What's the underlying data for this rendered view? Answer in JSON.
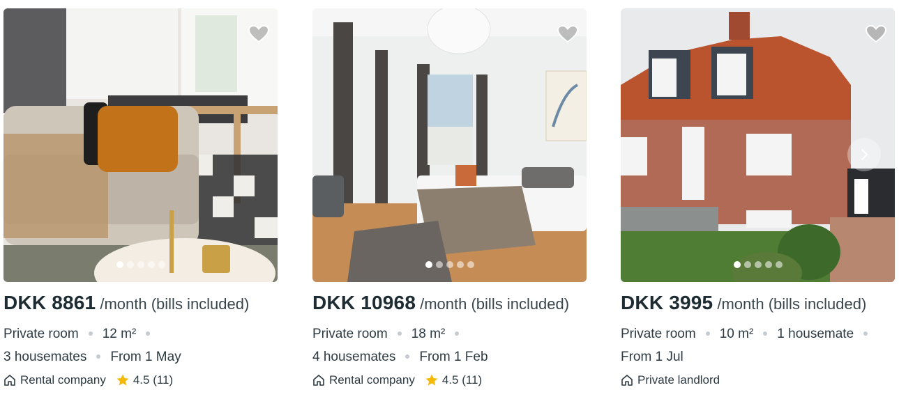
{
  "listings": [
    {
      "price": "DKK 8861",
      "period": "/month (bills included)",
      "room_type": "Private room",
      "size": "12 m²",
      "housemates": "3 housemates",
      "available": "From 1 May",
      "owner_type": "Rental company",
      "rating": "4.5 (11)",
      "icons": [
        "heart-icon",
        "home-icon",
        "star-icon"
      ],
      "carousel": {
        "dots": 5,
        "active": 0
      }
    },
    {
      "price": "DKK 10968",
      "period": "/month (bills included)",
      "room_type": "Private room",
      "size": "18 m²",
      "housemates": "4 housemates",
      "available": "From 1 Feb",
      "owner_type": "Rental company",
      "rating": "4.5 (11)",
      "icons": [
        "heart-icon",
        "home-icon",
        "star-icon"
      ],
      "carousel": {
        "dots": 5,
        "active": 0
      }
    },
    {
      "price": "DKK 3995",
      "period": "/month (bills included)",
      "room_type": "Private room",
      "size": "10 m²",
      "housemates": "1 housemate",
      "available": "From 1 Jul",
      "owner_type": "Private landlord",
      "icons": [
        "heart-icon",
        "chevron-right-icon",
        "home-icon"
      ],
      "carousel": {
        "dots": 5,
        "active": 0
      }
    }
  ],
  "colors": {
    "text": "#1d2b33",
    "muted": "#2d3a41",
    "separator": "#c5cbd0",
    "star": "#f5b90a"
  }
}
